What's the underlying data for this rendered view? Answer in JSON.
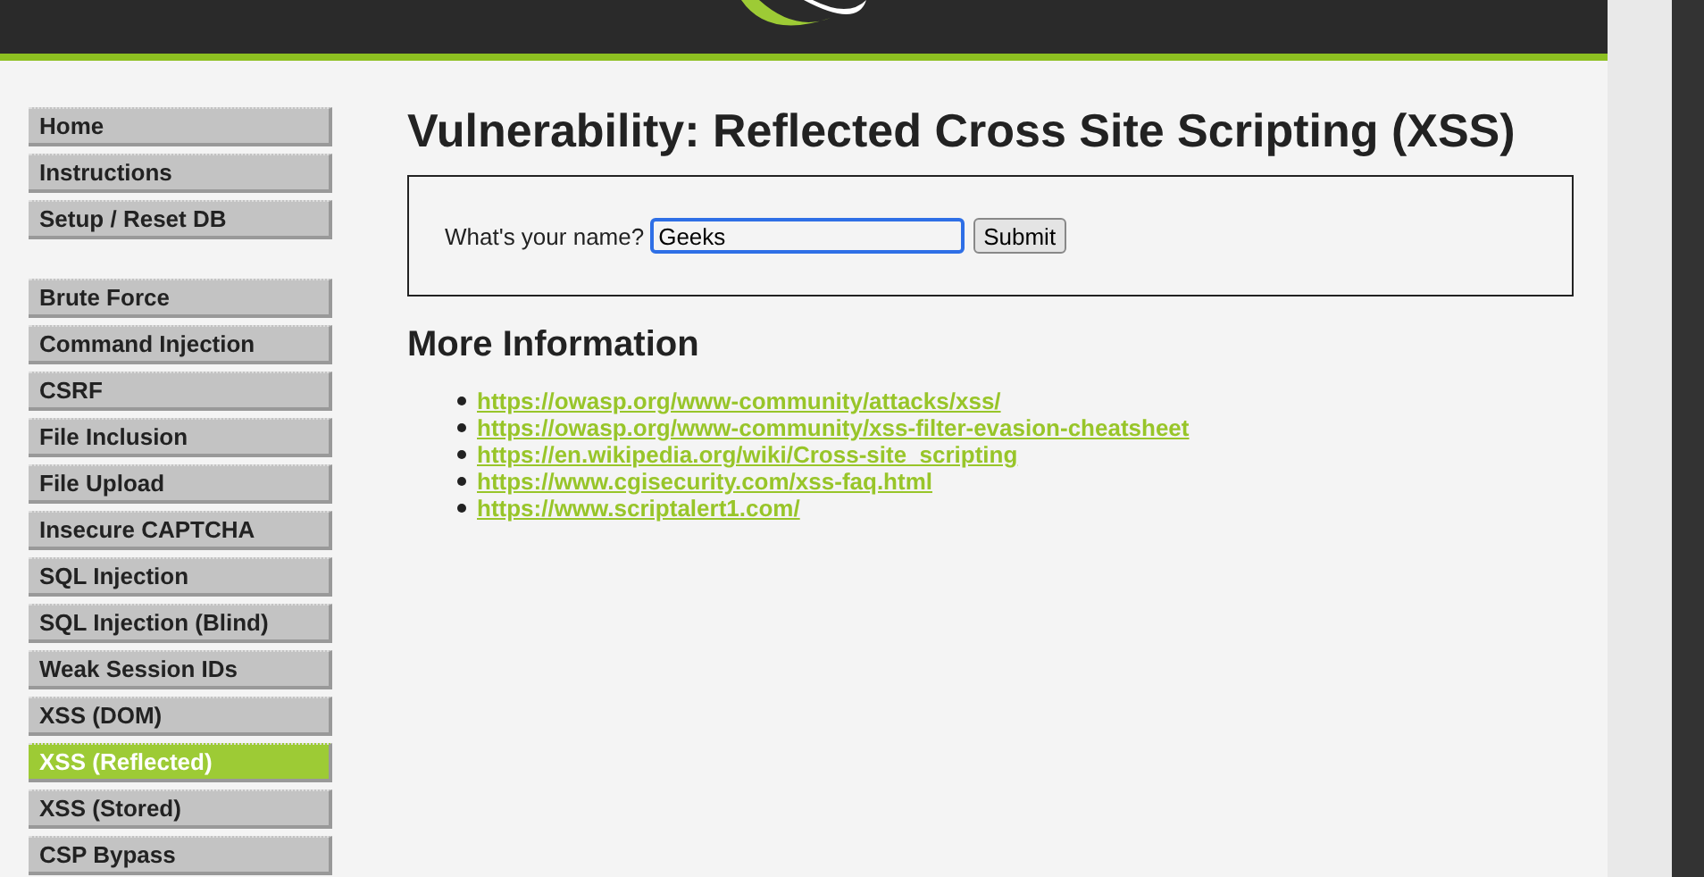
{
  "menu_groups": [
    {
      "items": [
        {
          "label": "Home",
          "selected": false
        },
        {
          "label": "Instructions",
          "selected": false
        },
        {
          "label": "Setup / Reset DB",
          "selected": false
        }
      ]
    },
    {
      "items": [
        {
          "label": "Brute Force",
          "selected": false
        },
        {
          "label": "Command Injection",
          "selected": false
        },
        {
          "label": "CSRF",
          "selected": false
        },
        {
          "label": "File Inclusion",
          "selected": false
        },
        {
          "label": "File Upload",
          "selected": false
        },
        {
          "label": "Insecure CAPTCHA",
          "selected": false
        },
        {
          "label": "SQL Injection",
          "selected": false
        },
        {
          "label": "SQL Injection (Blind)",
          "selected": false
        },
        {
          "label": "Weak Session IDs",
          "selected": false
        },
        {
          "label": "XSS (DOM)",
          "selected": false
        },
        {
          "label": "XSS (Reflected)",
          "selected": true
        },
        {
          "label": "XSS (Stored)",
          "selected": false
        },
        {
          "label": "CSP Bypass",
          "selected": false
        }
      ]
    }
  ],
  "main": {
    "title": "Vulnerability: Reflected Cross Site Scripting (XSS)",
    "form": {
      "label": "What's your name?",
      "value": "Geeks",
      "button": "Submit"
    },
    "more_info_heading": "More Information",
    "links": [
      "https://owasp.org/www-community/attacks/xss/",
      "https://owasp.org/www-community/xss-filter-evasion-cheatsheet",
      "https://en.wikipedia.org/wiki/Cross-site_scripting",
      "https://www.cgisecurity.com/xss-faq.html",
      "https://www.scriptalert1.com/"
    ]
  }
}
